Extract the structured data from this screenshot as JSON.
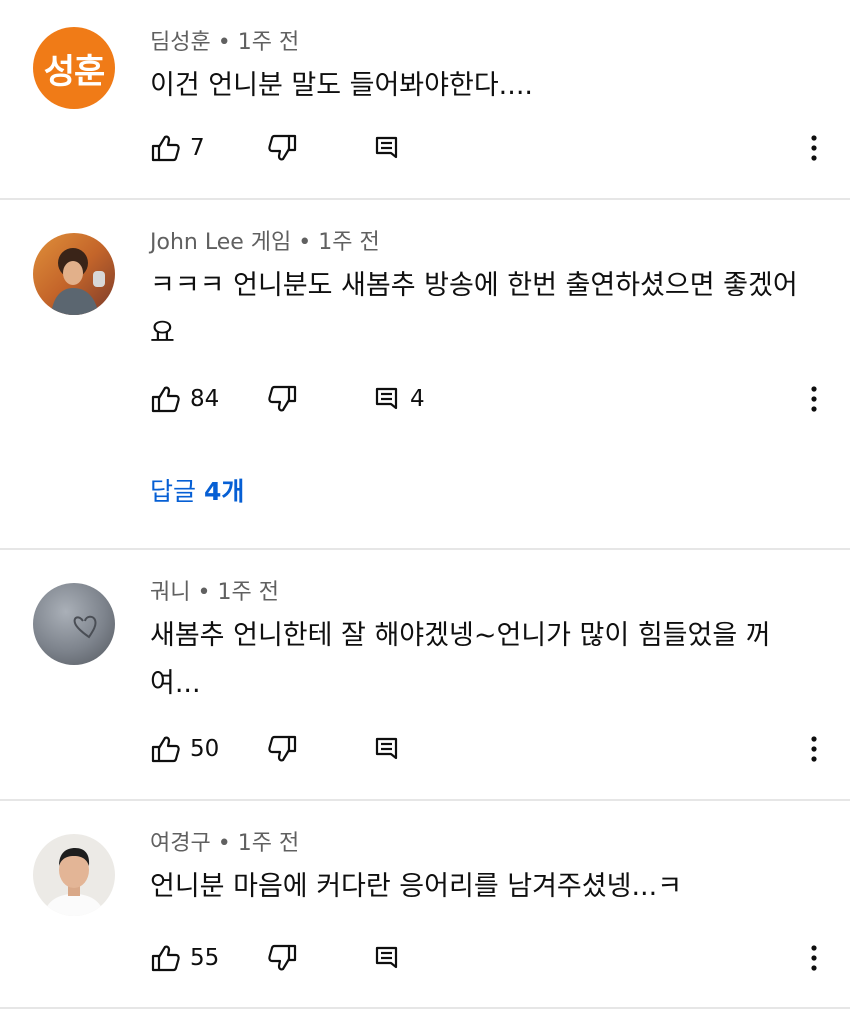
{
  "comments": [
    {
      "author": "딤성훈",
      "time": "1주 전",
      "avatar_text": "성훈",
      "avatar_color": "#f07b17",
      "text": "이건 언니분 말도 들어봐야한다....",
      "likes": "7",
      "replies_count": ""
    },
    {
      "author": "John Lee 게임",
      "time": "1주 전",
      "avatar_text": "",
      "text": "ㅋㅋㅋ 언니분도 새봄추 방송에 한번 출연하셨으면 좋겠어요",
      "likes": "84",
      "replies_count": "4",
      "replies_link_prefix": "답글",
      "replies_link_count": "4개"
    },
    {
      "author": "궈니",
      "time": "1주 전",
      "avatar_text": "",
      "text": "새봄추 언니한테 잘 해야겠넹~언니가 많이 힘들었을 꺼여...",
      "likes": "50",
      "replies_count": ""
    },
    {
      "author": "여경구",
      "time": "1주 전",
      "avatar_text": "",
      "text": "언니분 마음에 커다란 응어리를 남겨주셨넹...ㅋ",
      "likes": "55",
      "replies_count": ""
    }
  ],
  "separator": "•",
  "colors": {
    "link": "#065fd4",
    "meta": "#606060",
    "divider": "#e6e6e6"
  },
  "icons": {
    "like": "thumb-up-icon",
    "dislike": "thumb-down-icon",
    "reply": "reply-comment-icon",
    "more": "more-vertical-icon"
  }
}
